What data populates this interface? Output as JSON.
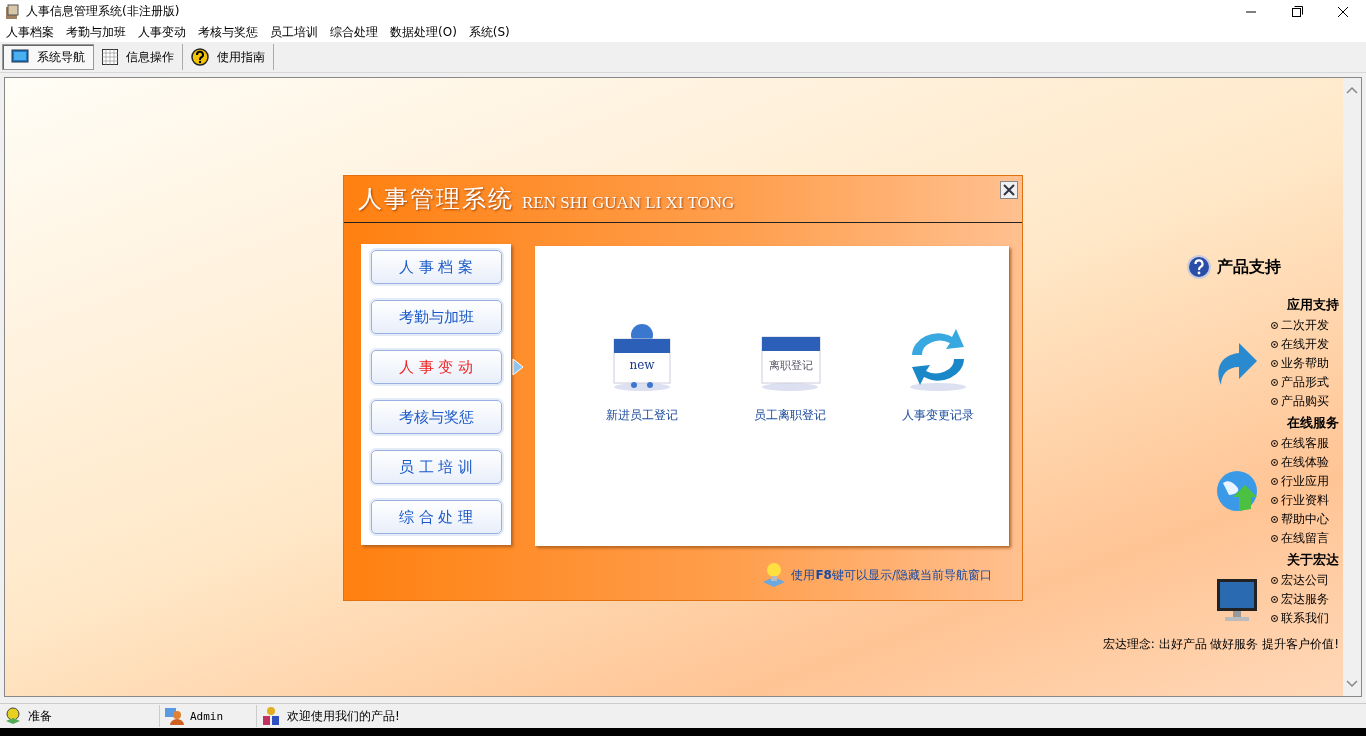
{
  "window": {
    "title": "人事信息管理系统(非注册版)"
  },
  "menu": [
    "人事档案",
    "考勤与加班",
    "人事变动",
    "考核与奖惩",
    "员工培训",
    "综合处理",
    "数据处理(O)",
    "系统(S)"
  ],
  "toolbar": [
    {
      "label": "系统导航",
      "selected": true
    },
    {
      "label": "信息操作",
      "selected": false
    },
    {
      "label": "使用指南",
      "selected": false
    }
  ],
  "dialog": {
    "title": "人事管理系统",
    "subtitle": "REN SHI GUAN LI XI TONG",
    "nav_buttons": [
      {
        "label": "人 事 档 案",
        "selected": false
      },
      {
        "label": "考勤与加班",
        "selected": false
      },
      {
        "label": "人 事 变 动",
        "selected": true
      },
      {
        "label": "考核与奖惩",
        "selected": false
      },
      {
        "label": "员 工 培 训",
        "selected": false
      },
      {
        "label": "综 合 处 理",
        "selected": false
      }
    ],
    "actions": [
      {
        "kind": "new",
        "label": "新进员工登记",
        "icon_text": "new"
      },
      {
        "kind": "leave",
        "label": "员工离职登记",
        "icon_text": "离职登记"
      },
      {
        "kind": "change",
        "label": "人事变更记录"
      }
    ],
    "hint": "使用**F8**键可以显示/隐藏当前导航窗口"
  },
  "support": {
    "title": "产品支持",
    "sections": [
      {
        "kind": "arrow",
        "heading": "应用支持",
        "links": [
          "二次开发",
          "在线开发",
          "业务帮助",
          "产品形式",
          "产品购买"
        ]
      },
      {
        "kind": "globe",
        "heading": "在线服务",
        "links": [
          "在线客服",
          "在线体验",
          "行业应用",
          "行业资料",
          "帮助中心",
          "在线留言"
        ]
      },
      {
        "kind": "monitor",
        "heading": "关于宏达",
        "links": [
          "宏达公司",
          "宏达服务",
          "联系我们"
        ]
      }
    ],
    "slogan": "宏达理念: 出好产品  做好服务  提升客户价值!"
  },
  "status_bar": [
    {
      "kind": "ready",
      "text": "准备"
    },
    {
      "kind": "user",
      "text": "Admin"
    },
    {
      "kind": "welcome",
      "text": "欢迎使用我们的产品!"
    }
  ]
}
